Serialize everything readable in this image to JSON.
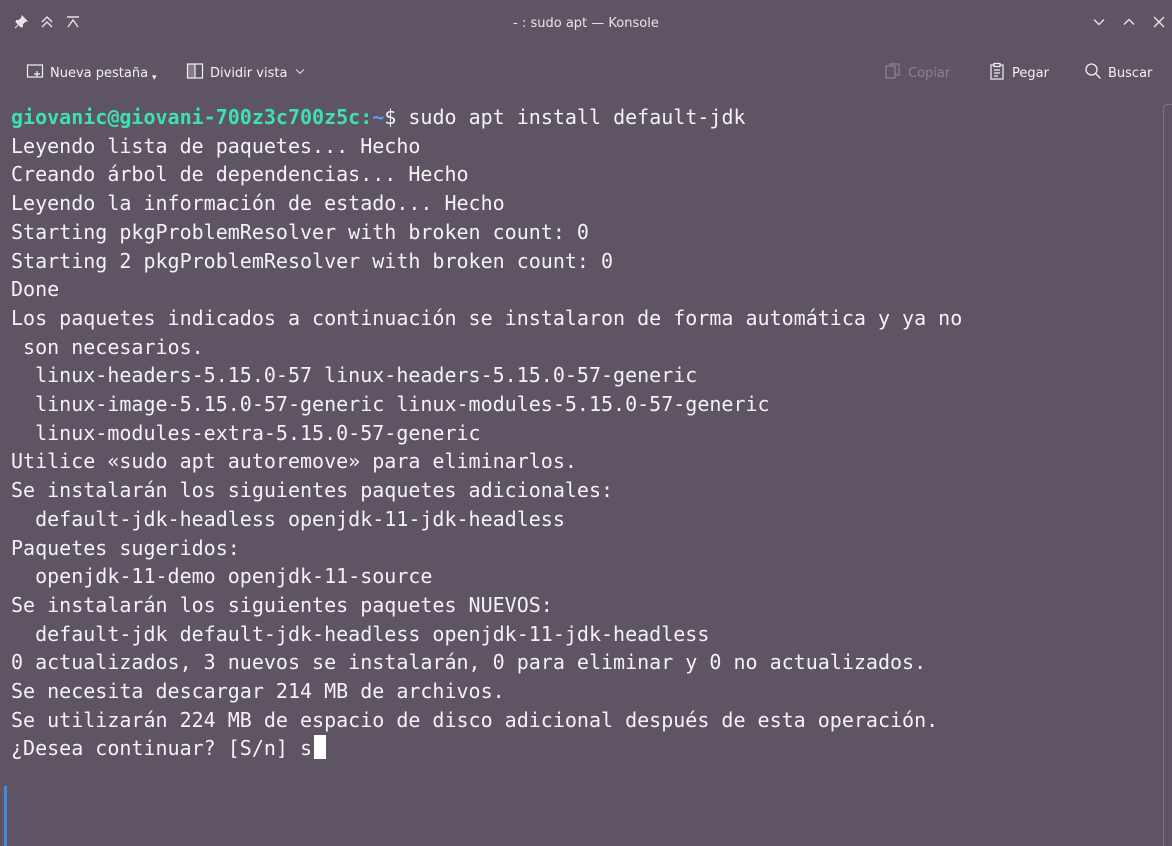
{
  "window": {
    "title": "- : sudo apt — Konsole"
  },
  "titlebar_icons": {
    "left": [
      "pin-icon",
      "keep-above-icon",
      "keep-below-icon"
    ],
    "right": [
      "minimize-icon",
      "maximize-icon",
      "close-icon"
    ]
  },
  "toolbar": {
    "new_tab": "Nueva pestaña",
    "split_view": "Dividir vista",
    "copy": "Copiar",
    "paste": "Pegar",
    "search": "Buscar"
  },
  "terminal": {
    "prompt_user": "giovanic@giovani-700z3c700z5c",
    "prompt_sep": ":",
    "prompt_path": "~",
    "prompt_symbol": "$",
    "command": " sudo apt install default-jdk",
    "output_lines": [
      "Leyendo lista de paquetes... Hecho",
      "Creando árbol de dependencias... Hecho",
      "Leyendo la información de estado... Hecho",
      "Starting pkgProblemResolver with broken count: 0",
      "Starting 2 pkgProblemResolver with broken count: 0",
      "Done",
      "Los paquetes indicados a continuación se instalaron de forma automática y ya no",
      " son necesarios.",
      "  linux-headers-5.15.0-57 linux-headers-5.15.0-57-generic",
      "  linux-image-5.15.0-57-generic linux-modules-5.15.0-57-generic",
      "  linux-modules-extra-5.15.0-57-generic",
      "Utilice «sudo apt autoremove» para eliminarlos.",
      "Se instalarán los siguientes paquetes adicionales:",
      "  default-jdk-headless openjdk-11-jdk-headless",
      "Paquetes sugeridos:",
      "  openjdk-11-demo openjdk-11-source",
      "Se instalarán los siguientes paquetes NUEVOS:",
      "  default-jdk default-jdk-headless openjdk-11-jdk-headless",
      "0 actualizados, 3 nuevos se instalarán, 0 para eliminar y 0 no actualizados.",
      "Se necesita descargar 214 MB de archivos.",
      "Se utilizarán 224 MB de espacio de disco adicional después de esta operación."
    ],
    "question": "¿Desea continuar? [S/n] ",
    "typed_input": "s"
  },
  "colors": {
    "background": "#5e5463",
    "prompt_user": "#3ee0b2",
    "prompt_path": "#5c9cf0",
    "text": "#f4f2f4",
    "accent": "#3d8ee0"
  }
}
